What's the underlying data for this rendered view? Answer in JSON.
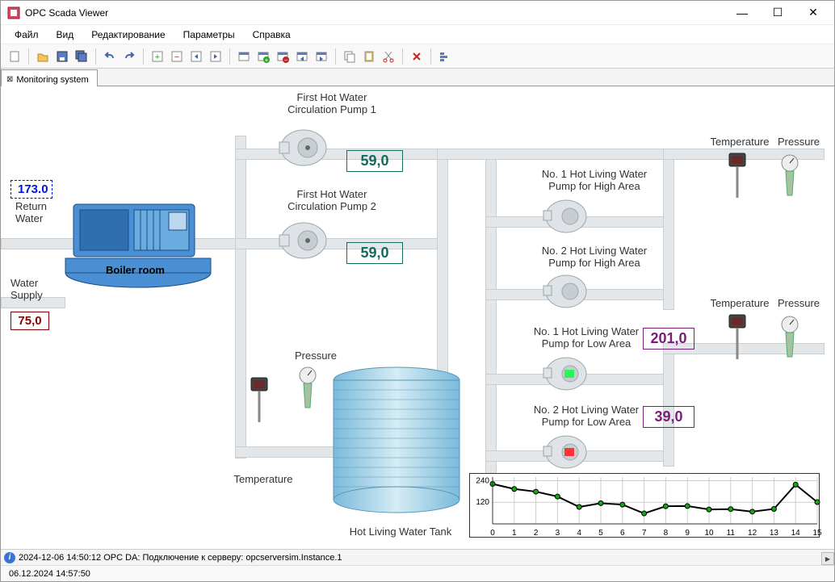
{
  "window": {
    "title": "OPC Scada Viewer"
  },
  "menu": {
    "items": [
      "Файл",
      "Вид",
      "Редактирование",
      "Параметры",
      "Справка"
    ]
  },
  "tab": {
    "label": "Monitoring system"
  },
  "labels": {
    "return_water": "Return Water",
    "water_supply": "Water Supply",
    "boiler_room": "Boiler room",
    "pump1": "First Hot Water Circulation Pump 1",
    "pump2": "First Hot Water Circulation Pump 2",
    "tank": "Hot Living Water Tank",
    "temperature": "Temperature",
    "pressure": "Pressure",
    "hp1": "No. 1 Hot Living Water Pump for High Area",
    "hp2": "No. 2 Hot Living Water Pump for High Area",
    "lp1": "No. 1 Hot Living Water Pump for Low Area",
    "lp2": "No. 2 Hot Living Water Pump for Low Area"
  },
  "values": {
    "return_water": "173.0",
    "water_supply": "75,0",
    "pump1": "59,0",
    "pump2": "59,0",
    "lp1": "201,0",
    "lp2": "39,0"
  },
  "status": {
    "log": "2024-12-06 14:50:12 OPC DA: Подключение к серверу: opcserversim.Instance.1",
    "time": "06.12.2024 14:57:50"
  },
  "chart_data": {
    "type": "line",
    "categories": [
      "0",
      "1",
      "2",
      "3",
      "4",
      "5",
      "6",
      "7",
      "8",
      "9",
      "10",
      "11",
      "12",
      "13",
      "14",
      "15"
    ],
    "values": [
      222,
      194,
      179,
      152,
      94,
      115,
      107,
      58,
      98,
      99,
      80,
      82,
      68,
      83,
      218,
      121
    ],
    "ylim": [
      0,
      260
    ],
    "yticks": [
      120,
      240
    ],
    "xlabel": "",
    "ylabel": "",
    "title": ""
  }
}
